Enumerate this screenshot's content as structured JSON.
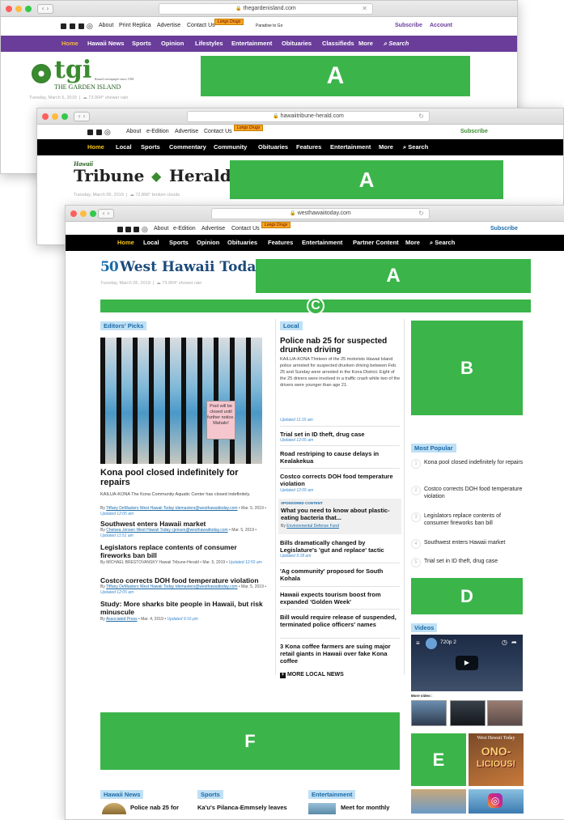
{
  "back": {
    "url": "thegardenisland.com",
    "util": {
      "about": "About",
      "print": "Print Replica",
      "advertise": "Advertise",
      "contact": "Contact Us",
      "deals": "Longs Drugs",
      "paradise": "Paradise to Go",
      "subscribe": "Subscribe",
      "account": "Account"
    },
    "nav": [
      "Home",
      "Hawaii News",
      "Sports",
      "Opinion",
      "Lifestyles",
      "Entertainment",
      "Obituaries",
      "Classifieds",
      "More",
      "Search"
    ],
    "logo_main": "tgi",
    "logo_sub": "THE GARDEN ISLAND",
    "logo_tag": "Kauai's newspaper since 1901",
    "date": "Tuesday, March 5, 2019",
    "weather": "73.904° shower rain",
    "ad_label": "A",
    "colors": {
      "nav": "#6a3d9a",
      "accent": "#f5b642"
    }
  },
  "mid": {
    "url": "hawaiitribune-herald.com",
    "util": {
      "about": "About",
      "edition": "e-Edition",
      "advertise": "Advertise",
      "contact": "Contact Us",
      "deals": "Longs Drugs",
      "subscribe": "Subscribe"
    },
    "nav": [
      "Home",
      "Local",
      "Sports",
      "Commentary",
      "Community",
      "Obituaries",
      "Features",
      "Entertainment",
      "More",
      "Search"
    ],
    "logo_small": "Hawaii",
    "logo_main": "Tribune",
    "logo_second": "Herald",
    "date": "Tuesday, March 05, 2019",
    "weather": "72.896° broken clouds",
    "ad_label": "A"
  },
  "front": {
    "url": "westhawaiitoday.com",
    "util": {
      "about": "About",
      "edition": "e-Edition",
      "advertise": "Advertise",
      "contact": "Contact Us",
      "deals": "Longs Drugs",
      "subscribe": "Subscribe"
    },
    "nav": [
      "Home",
      "Local",
      "Sports",
      "Opinion",
      "Obituaries",
      "Features",
      "Entertainment",
      "Partner Content",
      "More",
      "Search"
    ],
    "logo_num": "50",
    "logo_main": "West Hawaii Today",
    "date": "Tuesday, March 05, 2019",
    "weather": "73.904° shower rain",
    "ads": {
      "a": "A",
      "b": "B",
      "c": "C",
      "d": "D",
      "e": "E",
      "f": "F"
    },
    "editors": {
      "label": "Editors' Picks",
      "sign": "Pool will be closed until further notice. Mahalo!",
      "lead_title": "Kona pool closed indefinitely for repairs",
      "lead_text": "KAILUA-KONA The Kona Community Aquatic Center has closed indefinitely.",
      "lead_by": "By",
      "lead_author": "Tiffany DeMasters West Hawaii Today tdemasters@westhawaiitoday.com",
      "lead_date": " • Mar. 5, 2019 • ",
      "lead_updated": "Updated 12:05 am",
      "stories": [
        {
          "title": "Southwest enters Hawaii market",
          "by": "By",
          "author": "Chelsea Jensen West Hawaii Today cjensen@westhawaiitoday.com",
          "date": " • Mar. 5, 2019 • ",
          "updated": "Updated 11:51 am"
        },
        {
          "title": "Legislators replace contents of consumer fireworks ban bill",
          "by": "By MICHAEL BRESTOVANSKY Hawaii Tribune-Herald",
          "author": "",
          "date": " • Mar. 5, 2019 • ",
          "updated": "Updated 12:55 am"
        },
        {
          "title": "Costco corrects DOH food temperature violation",
          "by": "By",
          "author": "Tiffany DeMasters West Hawaii Today tdemasters@westhawaiitoday.com",
          "date": " • Mar. 5, 2019 • ",
          "updated": "Updated 12:05 am"
        },
        {
          "title": "Study: More sharks bite people in Hawaii, but risk minuscule",
          "by": "By",
          "author": "Associated Press",
          "date": " • Mar. 4, 2019 • ",
          "updated": "Updated 9:16 pm"
        }
      ]
    },
    "local": {
      "label": "Local",
      "lead_title": "Police nab 25 for suspected drunken driving",
      "lead_text": "KAILUA-KONA Thirteen of the 25 motorists Hawaii Island police arrested for suspected drunken driving between Feb. 25 and Sunday were arrested in the Kona District. Eight of the 25 drivers were involved in a traffic crash while two of the drivers were younger than age 21.",
      "lead_updated": "Updated 11:15 am",
      "items": [
        {
          "title": "Trial set in ID theft, drug case",
          "updated": "Updated 12:05 am"
        },
        {
          "title": "Road restriping to cause delays in Kealakekua",
          "updated": ""
        },
        {
          "title": "Costco corrects DOH food temperature violation",
          "updated": "Updated 12:05 am"
        }
      ],
      "sponsored": {
        "tag": "SPONSORED CONTENT",
        "title": "What you need to know about plastic-eating bacteria that...",
        "by": "By",
        "sponsor": "Environmental Defense Fund"
      },
      "items2": [
        {
          "title": "Bills dramatically changed by Legislature's 'gut and replace' tactic",
          "updated": "Updated 9:18 am"
        },
        {
          "title": "'Ag community' proposed for South Kohala",
          "updated": ""
        },
        {
          "title": "Hawaii expects tourism boost from expanded 'Golden Week'",
          "updated": ""
        },
        {
          "title": "Bill would require release of suspended, terminated police officers' names",
          "updated": ""
        },
        {
          "title": "3 Kona coffee farmers are suing major retail giants in Hawaii over fake Kona coffee",
          "updated": ""
        }
      ],
      "more": "MORE LOCAL NEWS"
    },
    "popular": {
      "label": "Most Popular",
      "items": [
        {
          "n": "1",
          "title": "Kona pool closed indefinitely for repairs"
        },
        {
          "n": "2",
          "title": "Costco corrects DOH food temperature violation"
        },
        {
          "n": "3",
          "title": "Legislators replace contents of consumer fireworks ban bill"
        },
        {
          "n": "4",
          "title": "Southwest enters Hawaii market"
        },
        {
          "n": "5",
          "title": "Trial set in ID theft, drug case"
        }
      ]
    },
    "videos": {
      "label": "Videos",
      "quality": "720p 2",
      "more": "More video :"
    },
    "promo": {
      "top": "West Hawaii Today",
      "big1": "ONO-",
      "big2": "LICIOUS!"
    },
    "bottom": {
      "hawaii": {
        "label": "Hawaii News",
        "title": "Police nab 25 for"
      },
      "sports": {
        "label": "Sports",
        "title": "Ka'u's Pilanca-Emmsely leaves"
      },
      "ent": {
        "label": "Entertainment",
        "title": "Meet for monthly"
      }
    }
  }
}
